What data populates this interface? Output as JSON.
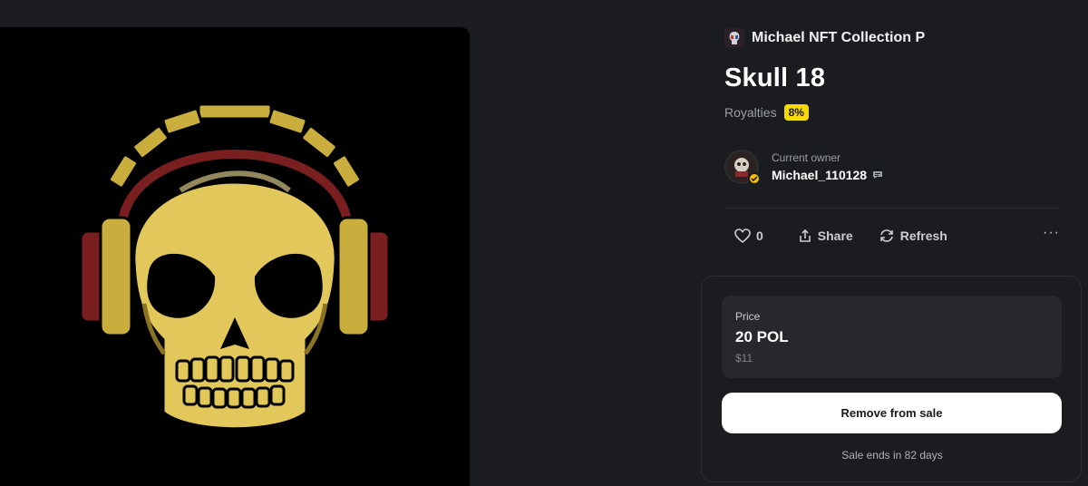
{
  "collection": {
    "name": "Michael NFT Collection P",
    "icon": "collection-avatar"
  },
  "item": {
    "title": "Skull 18",
    "royalties_label": "Royalties",
    "royalties_value": "8%",
    "artwork": "yellow-skull-with-headphones"
  },
  "owner": {
    "label": "Current owner",
    "name": "Michael_110128",
    "verified": true,
    "icons": [
      "verified-icon",
      "message-icon"
    ]
  },
  "actions": {
    "likes": "0",
    "share_label": "Share",
    "refresh_label": "Refresh",
    "icons": [
      "heart-icon",
      "share-icon",
      "refresh-icon",
      "more-icon"
    ]
  },
  "sale": {
    "price_label": "Price",
    "price": "20 POL",
    "price_usd": "$11",
    "remove_label": "Remove from sale",
    "ends_text": "Sale ends in 82 days"
  },
  "colors": {
    "background": "#1a1c1f",
    "accent_yellow": "#f5d90a",
    "skull_yellow": "#e2c85a",
    "headphone_red": "#7a1f20"
  }
}
